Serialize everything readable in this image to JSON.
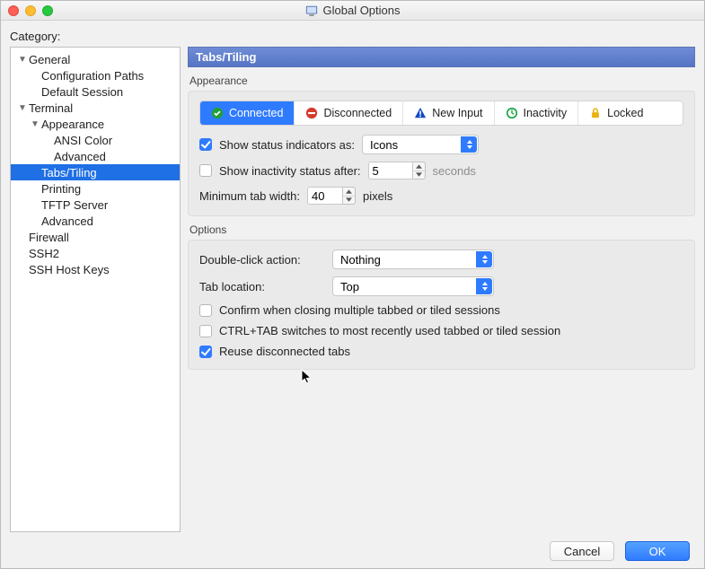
{
  "window": {
    "title": "Global Options"
  },
  "sidebar": {
    "label": "Category:",
    "items": [
      {
        "label": "General",
        "indent": 0,
        "arrow": true
      },
      {
        "label": "Configuration Paths",
        "indent": 1,
        "arrow": false
      },
      {
        "label": "Default Session",
        "indent": 1,
        "arrow": false
      },
      {
        "label": "Terminal",
        "indent": 0,
        "arrow": true
      },
      {
        "label": "Appearance",
        "indent": 1,
        "arrow": true
      },
      {
        "label": "ANSI Color",
        "indent": 2,
        "arrow": false
      },
      {
        "label": "Advanced",
        "indent": 2,
        "arrow": false
      },
      {
        "label": "Tabs/Tiling",
        "indent": 1,
        "arrow": false,
        "selected": true
      },
      {
        "label": "Printing",
        "indent": 1,
        "arrow": false
      },
      {
        "label": "TFTP Server",
        "indent": 1,
        "arrow": false
      },
      {
        "label": "Advanced",
        "indent": 1,
        "arrow": false
      },
      {
        "label": "Firewall",
        "indent": 0,
        "arrow": false
      },
      {
        "label": "SSH2",
        "indent": 0,
        "arrow": false
      },
      {
        "label": "SSH Host Keys",
        "indent": 0,
        "arrow": false
      }
    ]
  },
  "section": {
    "title": "Tabs/Tiling"
  },
  "appearance": {
    "group_label": "Appearance",
    "status_items": {
      "connected": "Connected",
      "disconnected": "Disconnected",
      "new_input": "New Input",
      "inactivity": "Inactivity",
      "locked": "Locked"
    },
    "show_status_label": "Show status indicators as:",
    "show_status_value": "Icons",
    "inactivity_label": "Show inactivity status after:",
    "inactivity_value": "5",
    "inactivity_unit": "seconds",
    "min_tab_label": "Minimum tab width:",
    "min_tab_value": "40",
    "min_tab_unit": "pixels"
  },
  "options": {
    "group_label": "Options",
    "dblclick_label": "Double-click action:",
    "dblclick_value": "Nothing",
    "tabloc_label": "Tab location:",
    "tabloc_value": "Top",
    "confirm_close_label": "Confirm when closing multiple tabbed or tiled sessions",
    "ctrl_tab_label": "CTRL+TAB switches to most recently used tabbed or tiled session",
    "reuse_label": "Reuse disconnected tabs"
  },
  "footer": {
    "cancel": "Cancel",
    "ok": "OK"
  }
}
